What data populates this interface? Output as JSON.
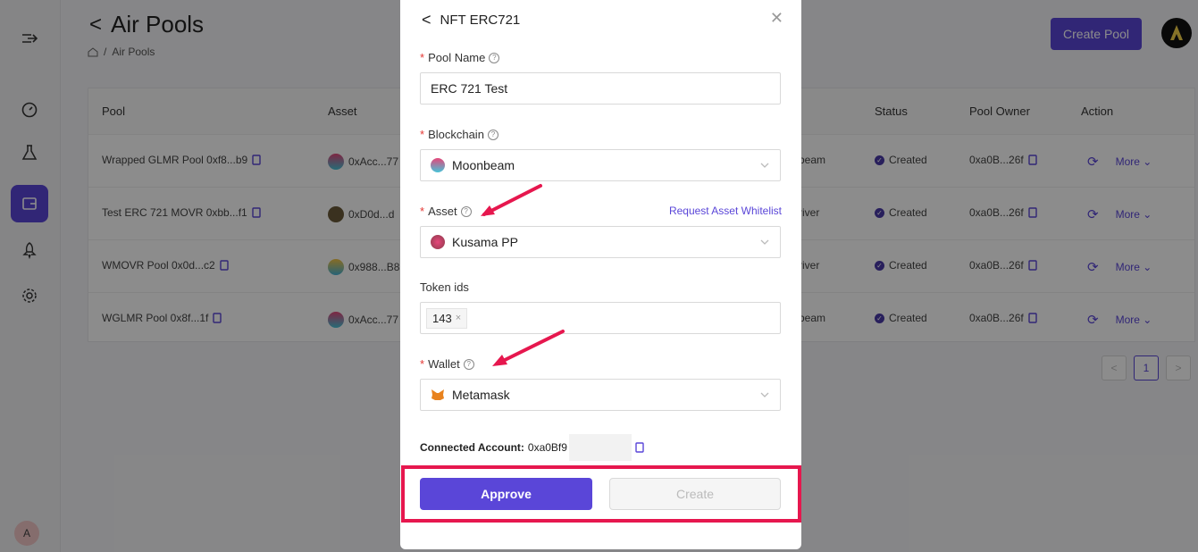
{
  "sidebar": {
    "avatar_initial": "A",
    "items": [
      {
        "icon": "expand-menu-icon"
      },
      {
        "icon": "dashboard-gauge-icon"
      },
      {
        "icon": "flask-icon"
      },
      {
        "icon": "wallet-icon",
        "active": true
      },
      {
        "icon": "rocket-icon"
      },
      {
        "icon": "gear-icon"
      }
    ]
  },
  "header": {
    "title": "Air Pools",
    "breadcrumb_current": "Air Pools",
    "create_pool": "Create Pool"
  },
  "table": {
    "columns": [
      "Pool",
      "Asset",
      "Status",
      "Pool Owner",
      "Action"
    ],
    "rows": [
      {
        "pool": "Wrapped GLMR Pool 0xf8...b9",
        "asset": "0xAcc...77",
        "chain": "beam",
        "status": "Created",
        "owner": "0xa0B...26f",
        "more": "More"
      },
      {
        "pool": "Test ERC 721 MOVR 0xbb...f1",
        "asset": "0xD0d...d",
        "chain": "river",
        "status": "Created",
        "owner": "0xa0B...26f",
        "more": "More"
      },
      {
        "pool": "WMOVR Pool 0x0d...c2",
        "asset": "0x988...B8",
        "chain": "river",
        "status": "Created",
        "owner": "0xa0B...26f",
        "more": "More"
      },
      {
        "pool": "WGLMR Pool 0x8f...1f",
        "asset": "0xAcc...77",
        "chain": "beam",
        "status": "Created",
        "owner": "0xa0B...26f",
        "more": "More"
      }
    ],
    "page": "1"
  },
  "modal": {
    "title": "NFT ERC721",
    "pool_name_label": "Pool Name",
    "pool_name_value": "ERC 721 Test",
    "blockchain_label": "Blockchain",
    "blockchain_value": "Moonbeam",
    "asset_label": "Asset",
    "asset_link": "Request Asset Whitelist",
    "asset_value": "Kusama PP",
    "token_ids_label": "Token ids",
    "token_tag": "143",
    "wallet_label": "Wallet",
    "wallet_value": "Metamask",
    "connected_label": "Connected Account:",
    "connected_value": "0xa0Bf9",
    "approve": "Approve",
    "create": "Create"
  },
  "colors": {
    "accent": "#5a46d8",
    "highlight": "#e6174e"
  }
}
